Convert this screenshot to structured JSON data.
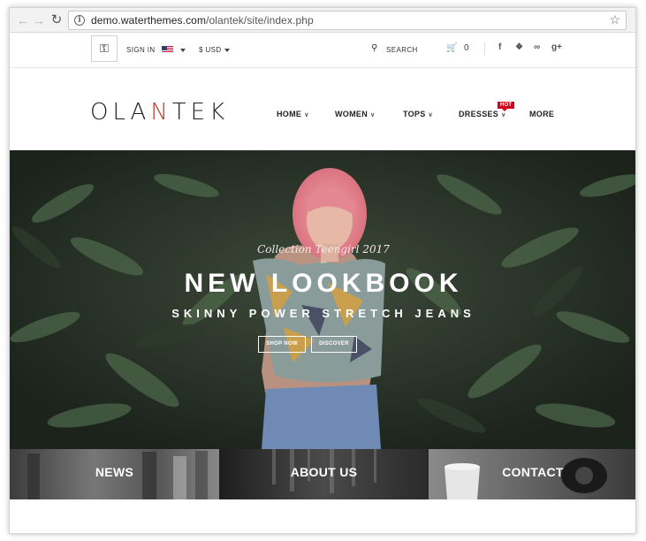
{
  "browser": {
    "url_domain": "demo.waterthemes.com",
    "url_path": "/olantek/site/index.php",
    "icons": [
      "back-icon",
      "forward-icon",
      "reload-icon",
      "info-icon",
      "bookmark-star-icon"
    ]
  },
  "topbar": {
    "sign_in": "SIGN IN",
    "currency": "$ USD",
    "search": "SEARCH",
    "cart_count": "0",
    "social_icons": [
      "facebook-icon",
      "twitter-icon",
      "rss-icon",
      "google-plus-icon"
    ]
  },
  "header": {
    "logo": {
      "left": "OLA",
      "n": "N",
      "right": "TEK"
    },
    "nav": [
      {
        "label": "HOME",
        "dropdown": true
      },
      {
        "label": "WOMEN",
        "dropdown": true
      },
      {
        "label": "TOPS",
        "dropdown": true
      },
      {
        "label": "DRESSES",
        "dropdown": true,
        "badge": "HOT"
      },
      {
        "label": "MORE",
        "dropdown": false
      }
    ]
  },
  "hero": {
    "subtitle": "Collection Teengirl 2017",
    "title": "NEW LOOKBOOK",
    "tagline": "SKINNY POWER STRETCH JEANS",
    "buttons": [
      "SHOP NOW",
      "DISCOVER"
    ]
  },
  "tiles": [
    {
      "label": "NEWS"
    },
    {
      "label": "ABOUT US"
    },
    {
      "label": "CONTACT"
    }
  ],
  "colors": {
    "accent": "#d0021b",
    "logo_n": "#c0392b",
    "text": "#222222"
  }
}
